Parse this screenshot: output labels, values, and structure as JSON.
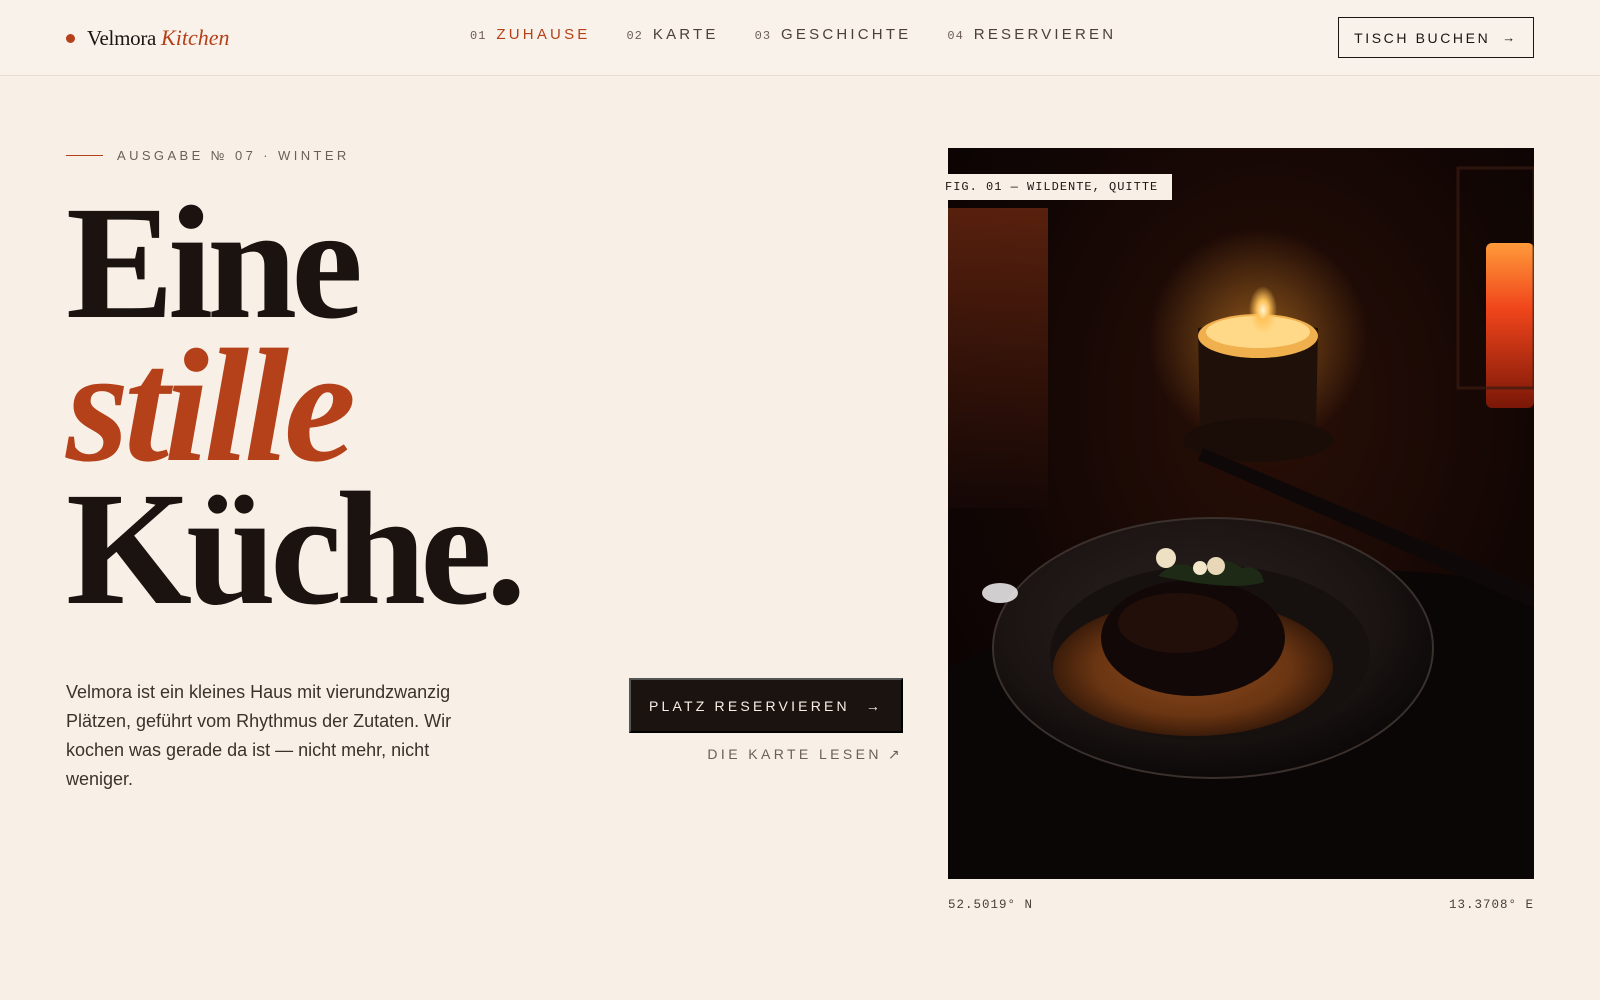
{
  "brand": {
    "name": "Velmora",
    "accent": "Kitchen",
    "dot_color": "#b4411a"
  },
  "nav": {
    "items": [
      {
        "num": "01",
        "label": "ZUHAUSE",
        "active": true
      },
      {
        "num": "02",
        "label": "KARTE",
        "active": false
      },
      {
        "num": "03",
        "label": "GESCHICHTE",
        "active": false
      },
      {
        "num": "04",
        "label": "RESERVIEREN",
        "active": false
      }
    ],
    "cta": {
      "label": "TISCH BUCHEN",
      "arrow": "→"
    }
  },
  "hero": {
    "issue": "AUSGABE № 07 · WINTER",
    "headline": {
      "line1": "Eine",
      "line2": "stille",
      "line3": "Küche."
    },
    "intro": "Velmora ist ein kleines Haus mit vierundzwanzig Plätzen, geführt vom Rhythmus der Zutaten. Wir kochen was gerade da ist — nicht mehr, nicht weniger.",
    "primary_cta": {
      "label": "PLATZ RESERVIEREN",
      "arrow": "→"
    },
    "secondary_link": {
      "label": "DIE KARTE LESEN",
      "arrow": "↗"
    }
  },
  "figure": {
    "caption": "FIG. 01 — WILDENTE, QUITTE",
    "latitude": "52.5019° N",
    "longitude": "13.3708° E"
  },
  "colors": {
    "accent": "#b4411a",
    "ink": "#1a1310",
    "paper": "#f8f0e6"
  }
}
